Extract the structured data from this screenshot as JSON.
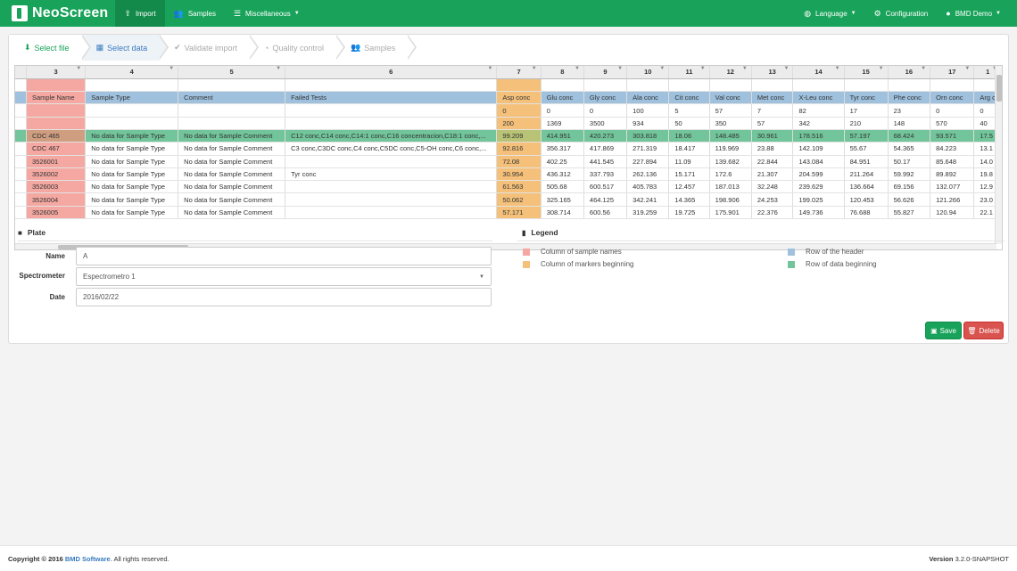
{
  "nav": {
    "brand": "NeoScreen",
    "items": [
      {
        "label": "Import",
        "icon": "upload-icon"
      },
      {
        "label": "Samples",
        "icon": "users-icon"
      },
      {
        "label": "Miscellaneous",
        "icon": "sliders-icon"
      }
    ],
    "right": [
      {
        "label": "Language",
        "icon": "globe-icon"
      },
      {
        "label": "Configuration",
        "icon": "cogs-icon"
      },
      {
        "label": "BMD Demo",
        "icon": "user-icon"
      }
    ]
  },
  "wizard": {
    "steps": [
      {
        "label": "Select file",
        "icon": "download-icon",
        "state": "done"
      },
      {
        "label": "Select data",
        "icon": "table-icon",
        "state": "current"
      },
      {
        "label": "Validate import",
        "icon": "check-circle-icon",
        "state": "todo"
      },
      {
        "label": "Quality control",
        "icon": "dashboard-icon",
        "state": "todo"
      },
      {
        "label": "Samples",
        "icon": "users-icon",
        "state": "todo"
      }
    ]
  },
  "sheet": {
    "col_headers": [
      "3",
      "4",
      "5",
      "6",
      "7",
      "8",
      "9",
      "10",
      "11",
      "12",
      "13",
      "14",
      "15",
      "16",
      "17",
      "1"
    ],
    "header_row": [
      "Sample Name",
      "Sample Type",
      "Comment",
      "Failed Tests",
      "Asp conc",
      "Glu conc",
      "Gly conc",
      "Ala conc",
      "Cit conc",
      "Val conc",
      "Met conc",
      "X-Leu conc",
      "Tyr conc",
      "Phe conc",
      "Orn conc",
      "Arg c"
    ],
    "rows": [
      [
        "",
        "",
        "",
        "",
        "0",
        "0",
        "0",
        "100",
        "5",
        "57",
        "7",
        "82",
        "17",
        "23",
        "0",
        "0"
      ],
      [
        "",
        "",
        "",
        "",
        "200",
        "1369",
        "3500",
        "934",
        "50",
        "350",
        "57",
        "342",
        "210",
        "148",
        "570",
        "40"
      ],
      [
        "CDC 465",
        "No data for Sample Type",
        "No data for Sample Comment",
        "C12 conc,C14 conc,C14:1 conc,C16 concentracion,C18:1 conc,...",
        "99.209",
        "414.951",
        "420.273",
        "303.818",
        "18.06",
        "148.485",
        "30.961",
        "178.516",
        "57.197",
        "68.424",
        "93.571",
        "17.5"
      ],
      [
        "CDC 467",
        "No data for Sample Type",
        "No data for Sample Comment",
        "C3 conc,C3DC conc,C4 conc,C5DC conc,C5-OH conc,C6 conc,...",
        "92.816",
        "356.317",
        "417.869",
        "271.319",
        "18.417",
        "119.969",
        "23.88",
        "142.109",
        "55.67",
        "54.365",
        "84.223",
        "13.1"
      ],
      [
        "3526001",
        "No data for Sample Type",
        "No data for Sample Comment",
        "",
        "72.08",
        "402.25",
        "441.545",
        "227.894",
        "11.09",
        "139.682",
        "22.844",
        "143.084",
        "84.951",
        "50.17",
        "85.648",
        "14.0"
      ],
      [
        "3526002",
        "No data for Sample Type",
        "No data for Sample Comment",
        "Tyr conc",
        "30.954",
        "436.312",
        "337.793",
        "262.136",
        "15.171",
        "172.6",
        "21.307",
        "204.599",
        "211.264",
        "59.992",
        "89.892",
        "19.8"
      ],
      [
        "3526003",
        "No data for Sample Type",
        "No data for Sample Comment",
        "",
        "61.563",
        "505.68",
        "600.517",
        "405.783",
        "12.457",
        "187.013",
        "32.248",
        "239.629",
        "136.664",
        "69.156",
        "132.077",
        "12.9"
      ],
      [
        "3526004",
        "No data for Sample Type",
        "No data for Sample Comment",
        "",
        "50.062",
        "325.165",
        "464.125",
        "342.241",
        "14.365",
        "198.906",
        "24.253",
        "199.025",
        "120.453",
        "56.626",
        "121.266",
        "23.0"
      ],
      [
        "3526005",
        "No data for Sample Type",
        "No data for Sample Comment",
        "",
        "57.171",
        "308.714",
        "600.56",
        "319.259",
        "19.725",
        "175.901",
        "22.376",
        "149.736",
        "76.688",
        "55.827",
        "120.94",
        "22.1"
      ]
    ]
  },
  "plate": {
    "title": "Plate",
    "name_label": "Name",
    "name_value": "A",
    "spectrometer_label": "Spectrometer",
    "spectrometer_value": "Espectrometro 1",
    "date_label": "Date",
    "date_value": "2016/02/22"
  },
  "legend": {
    "title": "Legend",
    "items": [
      {
        "label": "Column of sample names",
        "color": "#f4a8a1"
      },
      {
        "label": "Column of markers beginning",
        "color": "#f4c07a"
      },
      {
        "label": "Row of the header",
        "color": "#9fc1de"
      },
      {
        "label": "Row of data beginning",
        "color": "#72c49a"
      }
    ]
  },
  "actions": {
    "save": "Save",
    "delete": "Delete"
  },
  "footer": {
    "copyright": "Copyright © 2016",
    "company": "BMD Software",
    "rights": ". All rights reserved.",
    "version_label": "Version",
    "version_value": "3.2.0-SNAPSHOT"
  }
}
